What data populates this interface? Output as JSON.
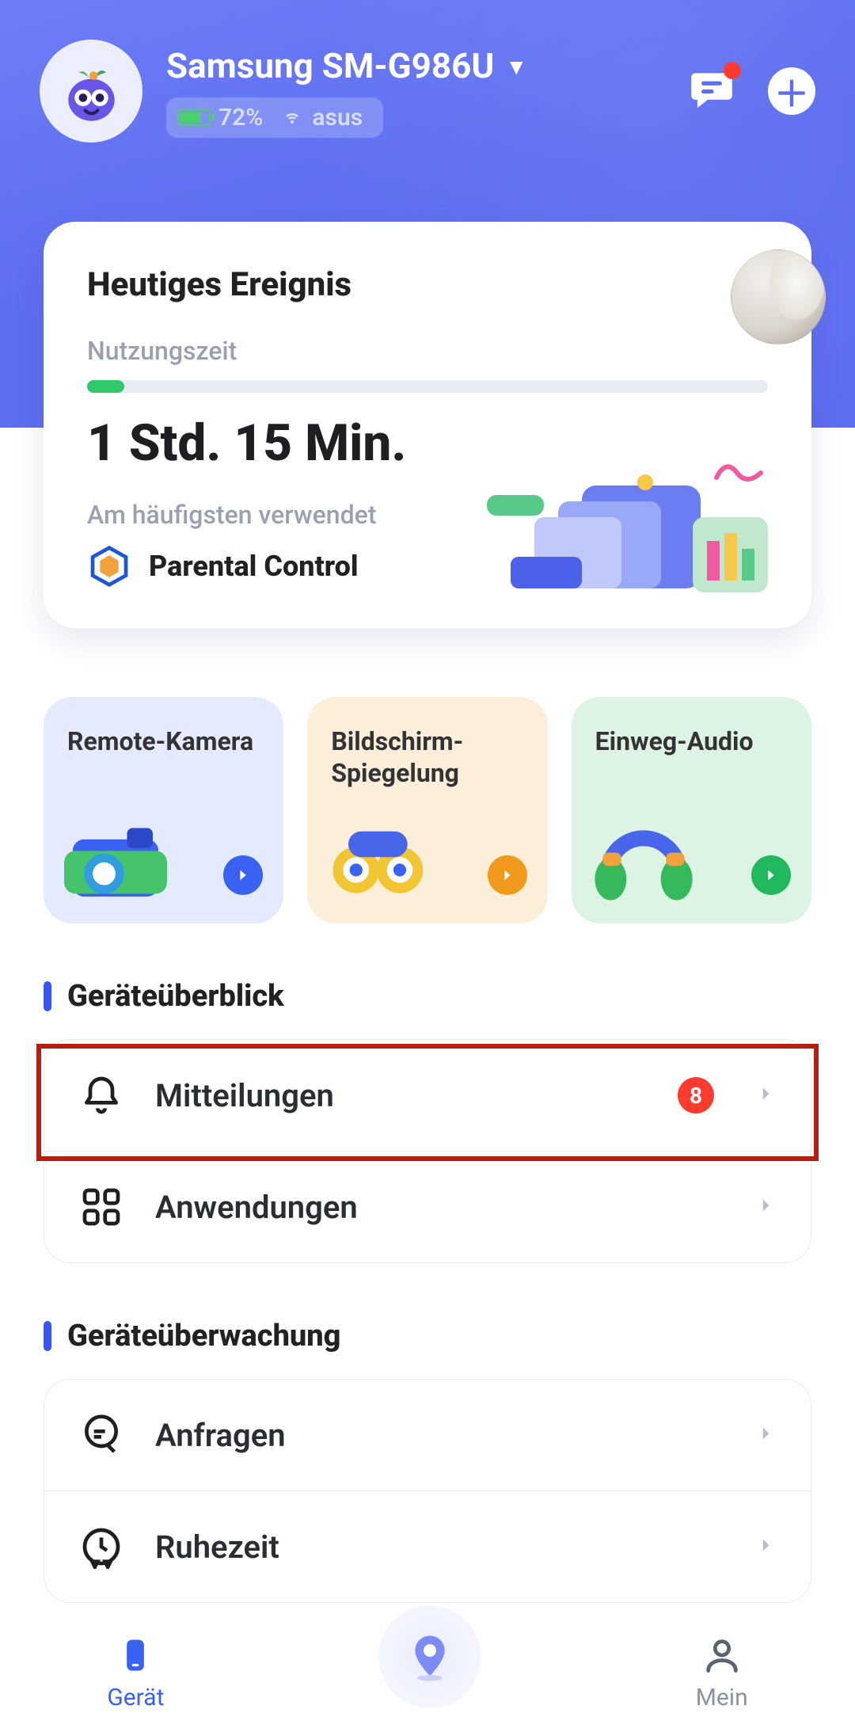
{
  "header": {
    "device_name": "Samsung SM-G986U",
    "battery_percent": "72%",
    "wifi_name": "asus"
  },
  "event_card": {
    "title": "Heutiges Ereignis",
    "usage_label": "Nutzungszeit",
    "usage_value": "1 Std. 15 Min.",
    "progress_fraction": 0.055,
    "most_used_label": "Am häufigsten verwendet",
    "most_used_app": "Parental Control"
  },
  "tiles": [
    {
      "label": "Remote-Kamera",
      "color": "blue",
      "icon": "camera"
    },
    {
      "label": "Bildschirm-Spiegelung",
      "color": "orange",
      "icon": "binoculars"
    },
    {
      "label": "Einweg-Audio",
      "color": "green",
      "icon": "headphones"
    }
  ],
  "overview": {
    "heading": "Geräteüberblick",
    "items": [
      {
        "label": "Mitteilungen",
        "icon": "bell",
        "badge": "8"
      },
      {
        "label": "Anwendungen",
        "icon": "apps",
        "badge": null
      }
    ]
  },
  "monitoring": {
    "heading": "Geräteüberwachung",
    "items": [
      {
        "label": "Anfragen",
        "icon": "request"
      },
      {
        "label": "Ruhezeit",
        "icon": "downtime"
      }
    ]
  },
  "bottom_nav": {
    "device": "Gerät",
    "mine": "Mein"
  },
  "colors": {
    "primary": "#5d6ef0",
    "green": "#31c96a",
    "badge_red": "#ff3b30"
  }
}
